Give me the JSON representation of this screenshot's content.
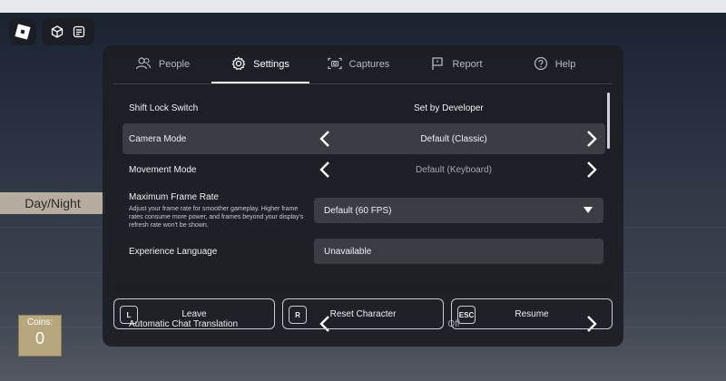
{
  "hud": {
    "day_night_label": "Day/Night",
    "coins_label": "Coins:",
    "coins_value": "0"
  },
  "tabs": [
    {
      "label": "People",
      "icon": "people-icon"
    },
    {
      "label": "Settings",
      "icon": "gear-icon"
    },
    {
      "label": "Captures",
      "icon": "camera-icon"
    },
    {
      "label": "Report",
      "icon": "flag-icon"
    },
    {
      "label": "Help",
      "icon": "help-icon"
    }
  ],
  "active_tab": "Settings",
  "settings": {
    "shift_lock": {
      "label": "Shift Lock Switch",
      "value": "Set by Developer"
    },
    "camera_mode": {
      "label": "Camera Mode",
      "value": "Default (Classic)"
    },
    "movement_mode": {
      "label": "Movement Mode",
      "value": "Default (Keyboard)"
    },
    "max_frame_rate": {
      "label": "Maximum Frame Rate",
      "description": "Adjust your frame rate for smoother gameplay. Higher frame rates consume more power, and frames beyond your display's refresh rate won't be shown.",
      "value": "Default (60 FPS)"
    },
    "experience_language": {
      "label": "Experience Language",
      "value": "Unavailable"
    },
    "chat_translation": {
      "label": "Automatic Chat Translation",
      "value": "Off"
    }
  },
  "actions": [
    {
      "key": "L",
      "label": "Leave"
    },
    {
      "key": "R",
      "label": "Reset Character"
    },
    {
      "key": "ESC",
      "label": "Resume"
    }
  ],
  "colors": {
    "panel_bg": "#1c1e24",
    "highlight_row": "#3a3d44",
    "text": "#f0f0f0"
  }
}
